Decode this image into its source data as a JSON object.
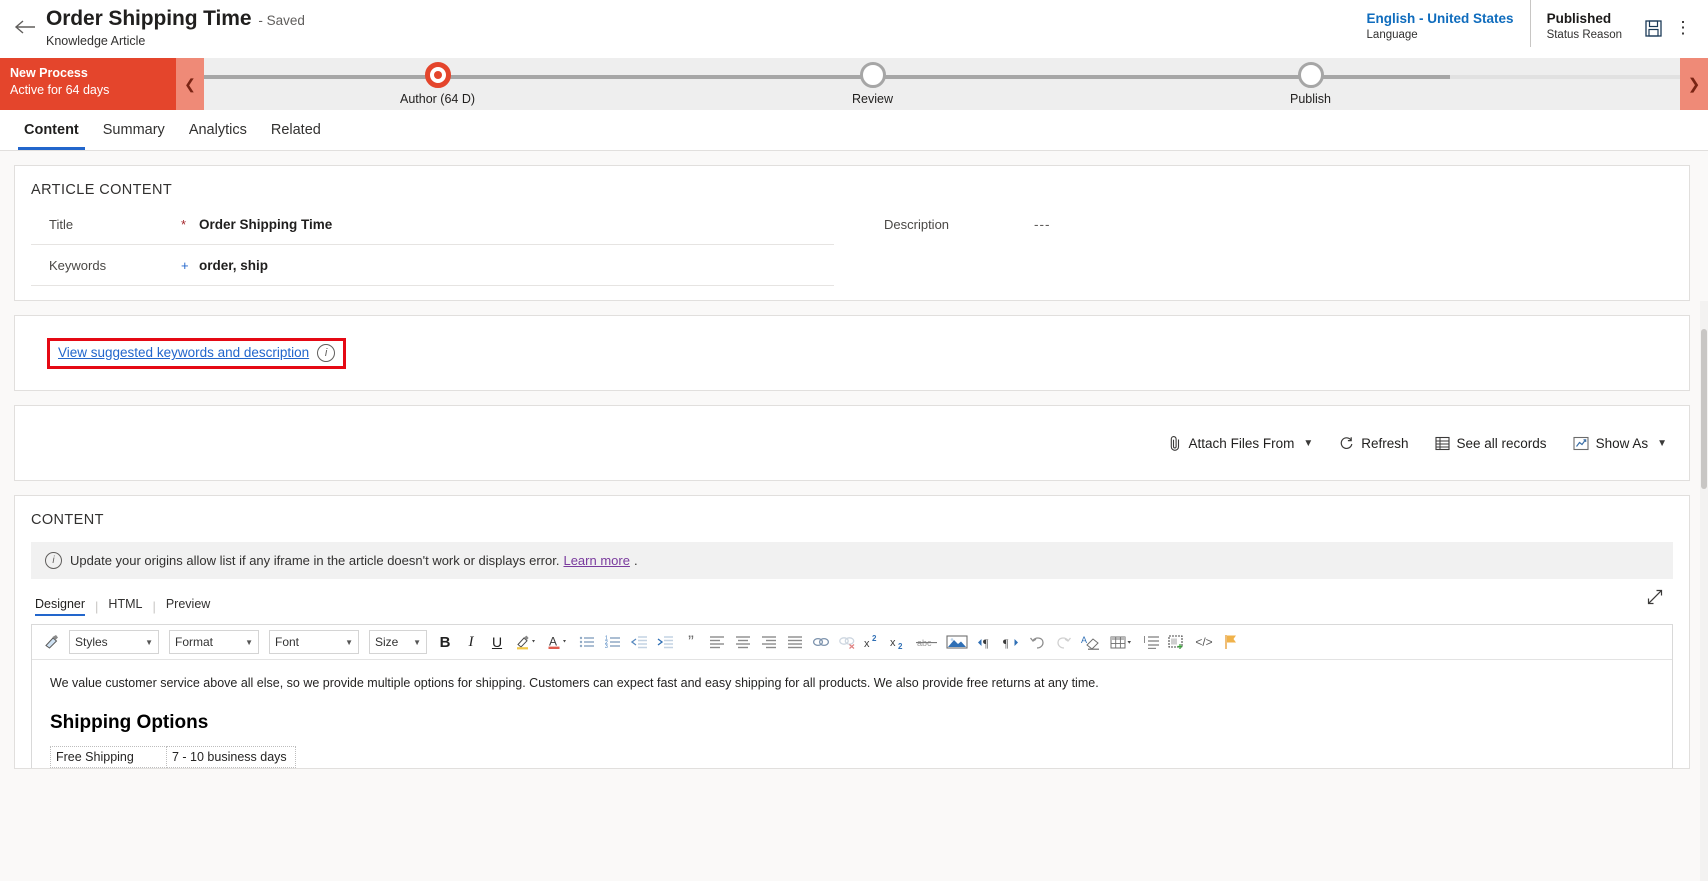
{
  "header": {
    "back_icon": "back-arrow-icon",
    "title": "Order Shipping Time",
    "saved_state": "- Saved",
    "entity": "Knowledge Article",
    "language_value": "English - United States",
    "language_label": "Language",
    "status_value": "Published",
    "status_label": "Status Reason",
    "save_icon": "save-icon",
    "more_icon": "more-commands-icon"
  },
  "process": {
    "stage_name": "New Process",
    "stage_active": "Active for 64 days",
    "collapse_icon": "chevron-left-icon",
    "next_icon": "chevron-right-icon",
    "stages": [
      {
        "label": "Author  (64 D)",
        "state": "active"
      },
      {
        "label": "Review",
        "state": "pending"
      },
      {
        "label": "Publish",
        "state": "pending"
      }
    ]
  },
  "tabs": [
    {
      "label": "Content",
      "active": true
    },
    {
      "label": "Summary",
      "active": false
    },
    {
      "label": "Analytics",
      "active": false
    },
    {
      "label": "Related",
      "active": false
    }
  ],
  "article_content": {
    "section_title": "ARTICLE CONTENT",
    "fields": [
      {
        "label": "Title",
        "required": "*",
        "value": "Order Shipping Time"
      },
      {
        "label": "Keywords",
        "required": "+",
        "value": "order, ship"
      }
    ],
    "description_label": "Description",
    "description_value": "---"
  },
  "suggestions": {
    "link_text": "View suggested keywords and description",
    "info_icon": "info-icon"
  },
  "attachments_toolbar": {
    "attach_icon": "paperclip-icon",
    "attach_label": "Attach Files From",
    "refresh_icon": "refresh-icon",
    "refresh_label": "Refresh",
    "records_icon": "grid-icon",
    "records_label": "See all records",
    "showas_icon": "chart-icon",
    "showas_label": "Show As",
    "chevron_icon": "chevron-down-icon"
  },
  "content_section": {
    "section_title": "CONTENT",
    "notice_icon": "info-icon",
    "notice_text": "Update your origins allow list if any iframe in the article doesn't work or displays error.",
    "notice_link": "Learn more",
    "notice_tail": ".",
    "editor_tabs": [
      {
        "label": "Designer",
        "active": true
      },
      {
        "label": "HTML",
        "active": false
      },
      {
        "label": "Preview",
        "active": false
      }
    ],
    "expand_icon": "expand-icon"
  },
  "rte_toolbar": {
    "format_painter_icon": "format-painter-icon",
    "selects": [
      {
        "name": "styles",
        "label": "Styles"
      },
      {
        "name": "format",
        "label": "Format"
      },
      {
        "name": "font",
        "label": "Font"
      },
      {
        "name": "size",
        "label": "Size"
      }
    ],
    "buttons": [
      {
        "name": "bold-icon",
        "glyph": "B"
      },
      {
        "name": "italic-icon",
        "glyph": "I"
      },
      {
        "name": "underline-icon",
        "glyph": "U"
      },
      {
        "name": "highlight-color-icon",
        "glyph": ""
      },
      {
        "name": "font-color-icon",
        "glyph": "A"
      },
      {
        "name": "bulleted-list-icon",
        "glyph": ""
      },
      {
        "name": "numbered-list-icon",
        "glyph": ""
      },
      {
        "name": "decrease-indent-icon",
        "glyph": ""
      },
      {
        "name": "increase-indent-icon",
        "glyph": ""
      },
      {
        "name": "blockquote-icon",
        "glyph": "”"
      },
      {
        "name": "align-left-icon",
        "glyph": ""
      },
      {
        "name": "align-center-icon",
        "glyph": ""
      },
      {
        "name": "align-right-icon",
        "glyph": ""
      },
      {
        "name": "justify-icon",
        "glyph": ""
      },
      {
        "name": "insert-link-icon",
        "glyph": ""
      },
      {
        "name": "remove-link-icon",
        "glyph": ""
      },
      {
        "name": "superscript-icon",
        "glyph": "x"
      },
      {
        "name": "subscript-icon",
        "glyph": "x"
      },
      {
        "name": "strikethrough-icon",
        "glyph": "abc"
      },
      {
        "name": "insert-image-icon",
        "glyph": ""
      },
      {
        "name": "ltr-icon",
        "glyph": ""
      },
      {
        "name": "rtl-icon",
        "glyph": ""
      },
      {
        "name": "undo-icon",
        "glyph": ""
      },
      {
        "name": "redo-icon",
        "glyph": ""
      },
      {
        "name": "remove-format-icon",
        "glyph": ""
      },
      {
        "name": "insert-table-icon",
        "glyph": ""
      },
      {
        "name": "line-height-icon",
        "glyph": ""
      },
      {
        "name": "insert-template-icon",
        "glyph": ""
      },
      {
        "name": "source-code-icon",
        "glyph": "</>"
      },
      {
        "name": "flag-icon",
        "glyph": ""
      }
    ]
  },
  "article_body": {
    "paragraph": "We value customer service above all else, so we provide multiple options for shipping. Customers can expect fast and easy shipping for all products. We also provide free returns at any time.",
    "heading": "Shipping Options",
    "table_rows": [
      {
        "option": "Free Shipping",
        "duration": "7 - 10 business days"
      }
    ]
  }
}
